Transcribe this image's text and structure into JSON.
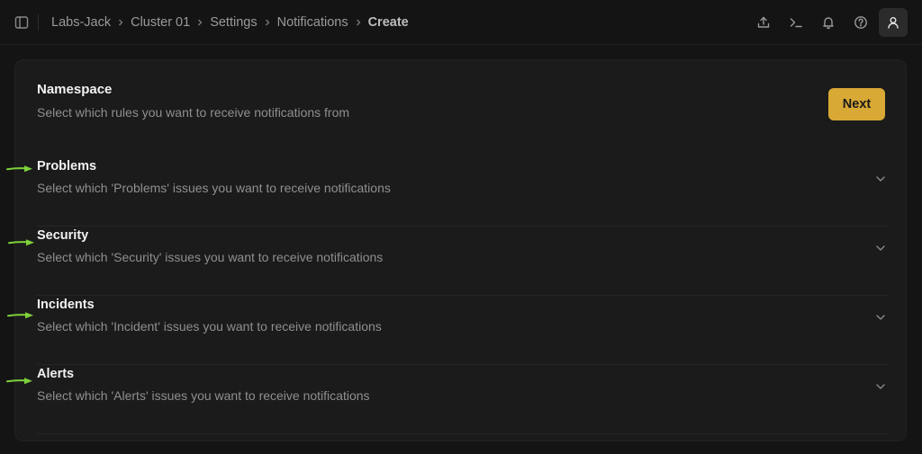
{
  "breadcrumb": {
    "items": [
      "Labs-Jack",
      "Cluster 01",
      "Settings",
      "Notifications"
    ],
    "current": "Create"
  },
  "icons": {
    "sidebar_toggle": "sidebar-panel-icon",
    "upload": "upload-icon",
    "terminal": "terminal-icon",
    "notifications": "bell-icon",
    "help": "help-circle-icon",
    "profile": "user-icon",
    "section_toggle": "chevron-down-icon",
    "annotation": "green-arrow-icon"
  },
  "colors": {
    "accent": "#d8a935",
    "annotation": "#7ed13b"
  },
  "namespace": {
    "title": "Namespace",
    "subtitle": "Select which rules you want to receive notifications from",
    "next_label": "Next"
  },
  "sections": [
    {
      "title": "Problems",
      "description": "Select which 'Problems' issues you want to receive notifications"
    },
    {
      "title": "Security",
      "description": "Select which 'Security' issues you want to receive notifications"
    },
    {
      "title": "Incidents",
      "description": "Select which 'Incident' issues you want to receive notifications"
    },
    {
      "title": "Alerts",
      "description": "Select which 'Alerts' issues you want to receive notifications"
    }
  ]
}
